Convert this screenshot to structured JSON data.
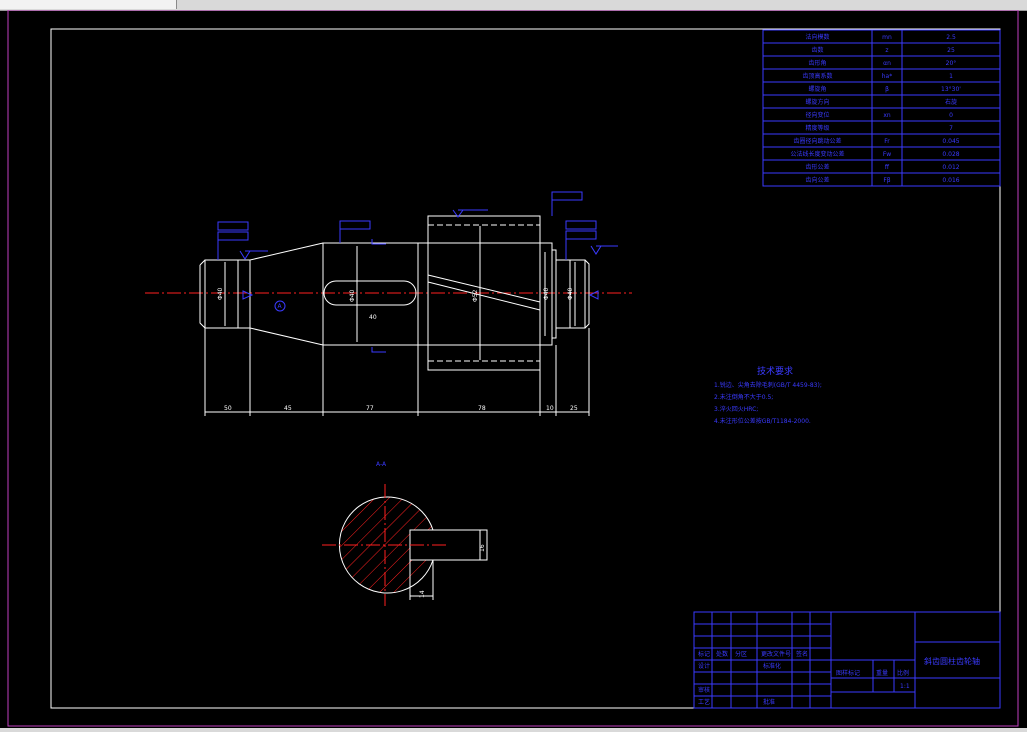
{
  "colors": {
    "background": "#000000",
    "frame_outer": "#c040c0",
    "line_outline": "#ffffff",
    "line_annotation": "#3a3aff",
    "line_center": "#ff2020"
  },
  "labels": {
    "title_block_name": "斜齿圆柱齿轮轴",
    "requirements_title": "技术要求",
    "requirements": [
      "1.锐边、尖角去除毛刺(GB/T 4459-83);",
      "2.未注倒角不大于0.5;",
      "3.淬火回火HRC;",
      "4.未注形位公差按GB/T1184-2000."
    ],
    "section_label": "A-A",
    "datum_marker": "A",
    "sheet_ratio": "1:1",
    "tb_labels": [
      "标记",
      "处数",
      "分区",
      "更改文件号",
      "签名",
      "设计",
      "审核",
      "工艺",
      "标准化",
      "批准",
      "图样标记",
      "重量",
      "比例"
    ]
  },
  "gear_table": {
    "rows": [
      [
        "法向模数",
        "mn",
        "2.5"
      ],
      [
        "齿数",
        "z",
        "25"
      ],
      [
        "齿形角",
        "αn",
        "20°"
      ],
      [
        "齿顶高系数",
        "ha*",
        "1"
      ],
      [
        "螺旋角",
        "β",
        "13°30'"
      ],
      [
        "螺旋方向",
        "",
        "右旋"
      ],
      [
        "径向变位",
        "xn",
        "0"
      ],
      [
        "精度等级",
        "",
        "7"
      ],
      [
        "齿圈径向跳动公差",
        "Fr",
        "0.045"
      ],
      [
        "公法线长度变动公差",
        "Fw",
        "0.028"
      ],
      [
        "齿形公差",
        "ff",
        "0.012"
      ],
      [
        "齿向公差",
        "Fβ",
        "0.016"
      ]
    ]
  },
  "dimensions": {
    "lengths": [
      "50",
      "45",
      "77",
      "78",
      "10",
      "25"
    ],
    "diameters": [
      "Φ40",
      "Φ40",
      "Φ52",
      "Φ40",
      "Φ40"
    ],
    "key_width": "40",
    "key_depth": "16",
    "section_keyway": "14"
  }
}
